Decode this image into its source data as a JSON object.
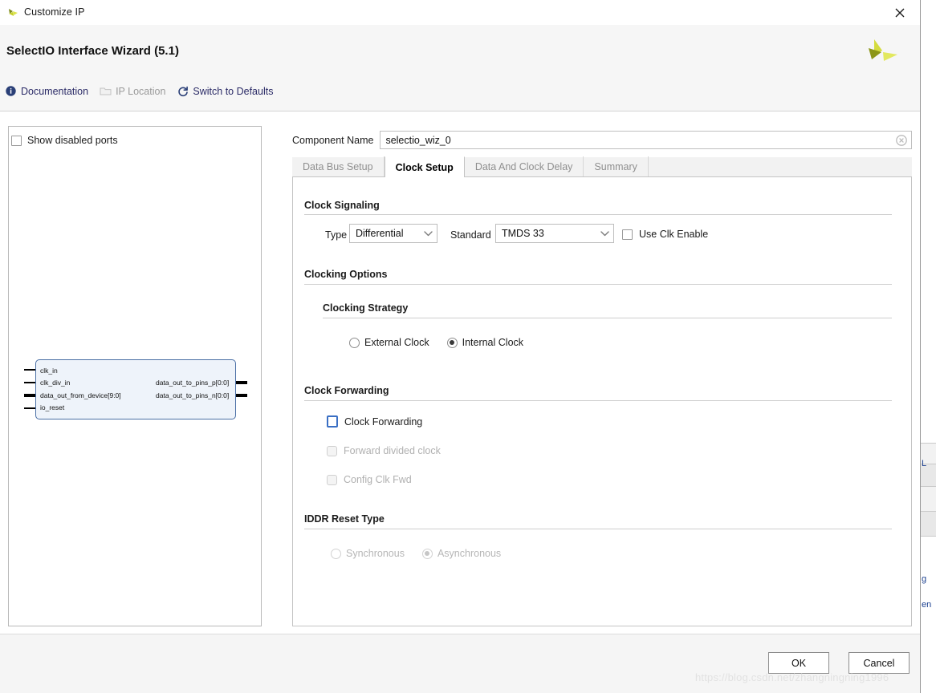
{
  "window": {
    "title": "Customize IP",
    "icon": "xilinx-logo-icon",
    "close_label": "✕"
  },
  "header": {
    "title": "SelectIO Interface Wizard (5.1)",
    "logo": "xilinx-logo",
    "links": [
      {
        "label": "Documentation",
        "icon": "info-icon",
        "enabled": true
      },
      {
        "label": "IP Location",
        "icon": "folder-icon",
        "enabled": false
      },
      {
        "label": "Switch to Defaults",
        "icon": "refresh-icon",
        "enabled": true
      }
    ]
  },
  "left_panel": {
    "show_disabled_ports": {
      "label": "Show disabled ports",
      "checked": false
    },
    "symbol": {
      "inputs": [
        "clk_in",
        "clk_div_in",
        "data_out_from_device[9:0]",
        "io_reset"
      ],
      "outputs": [
        "data_out_to_pins_p[0:0]",
        "data_out_to_pins_n[0:0]"
      ]
    }
  },
  "component_name": {
    "label": "Component Name",
    "value": "selectio_wiz_0",
    "clear_icon": "clear-circle-icon"
  },
  "tabs": [
    {
      "label": "Data Bus Setup",
      "active": false
    },
    {
      "label": "Clock Setup",
      "active": true
    },
    {
      "label": "Data And Clock Delay",
      "active": false
    },
    {
      "label": "Summary",
      "active": false
    }
  ],
  "clock_signaling": {
    "title": "Clock Signaling",
    "type_label": "Type",
    "type_value": "Differential",
    "standard_label": "Standard",
    "standard_value": "TMDS 33",
    "use_clk_enable": {
      "label": "Use Clk Enable",
      "checked": false
    }
  },
  "clocking_options": {
    "title": "Clocking Options",
    "strategy_title": "Clocking Strategy",
    "options": [
      {
        "label": "External Clock",
        "selected": false
      },
      {
        "label": "Internal Clock",
        "selected": true
      }
    ]
  },
  "clock_forwarding": {
    "title": "Clock Forwarding",
    "checkboxes": [
      {
        "label": "Clock Forwarding",
        "checked": false,
        "enabled": true
      },
      {
        "label": "Forward divided clock",
        "checked": false,
        "enabled": false
      },
      {
        "label": "Config Clk Fwd",
        "checked": false,
        "enabled": false
      }
    ]
  },
  "iddr_reset_type": {
    "title": "IDDR Reset Type",
    "options": [
      {
        "label": "Synchronous",
        "selected": false,
        "enabled": false
      },
      {
        "label": "Asynchronous",
        "selected": true,
        "enabled": false
      }
    ]
  },
  "footer": {
    "ok_label": "OK",
    "cancel_label": "Cancel"
  },
  "watermark": "https://blog.csdn.net/zhangningning1996",
  "background": {
    "fragment_1": "L",
    "fragment_2": "g",
    "fragment_3": "en"
  },
  "colors": {
    "accent_blue": "#3a6fc4",
    "link_blue": "#2a2a66",
    "panel_bg": "#f6f6f6",
    "symbol_fill": "#eef3fa",
    "symbol_border": "#4a6fa5"
  }
}
